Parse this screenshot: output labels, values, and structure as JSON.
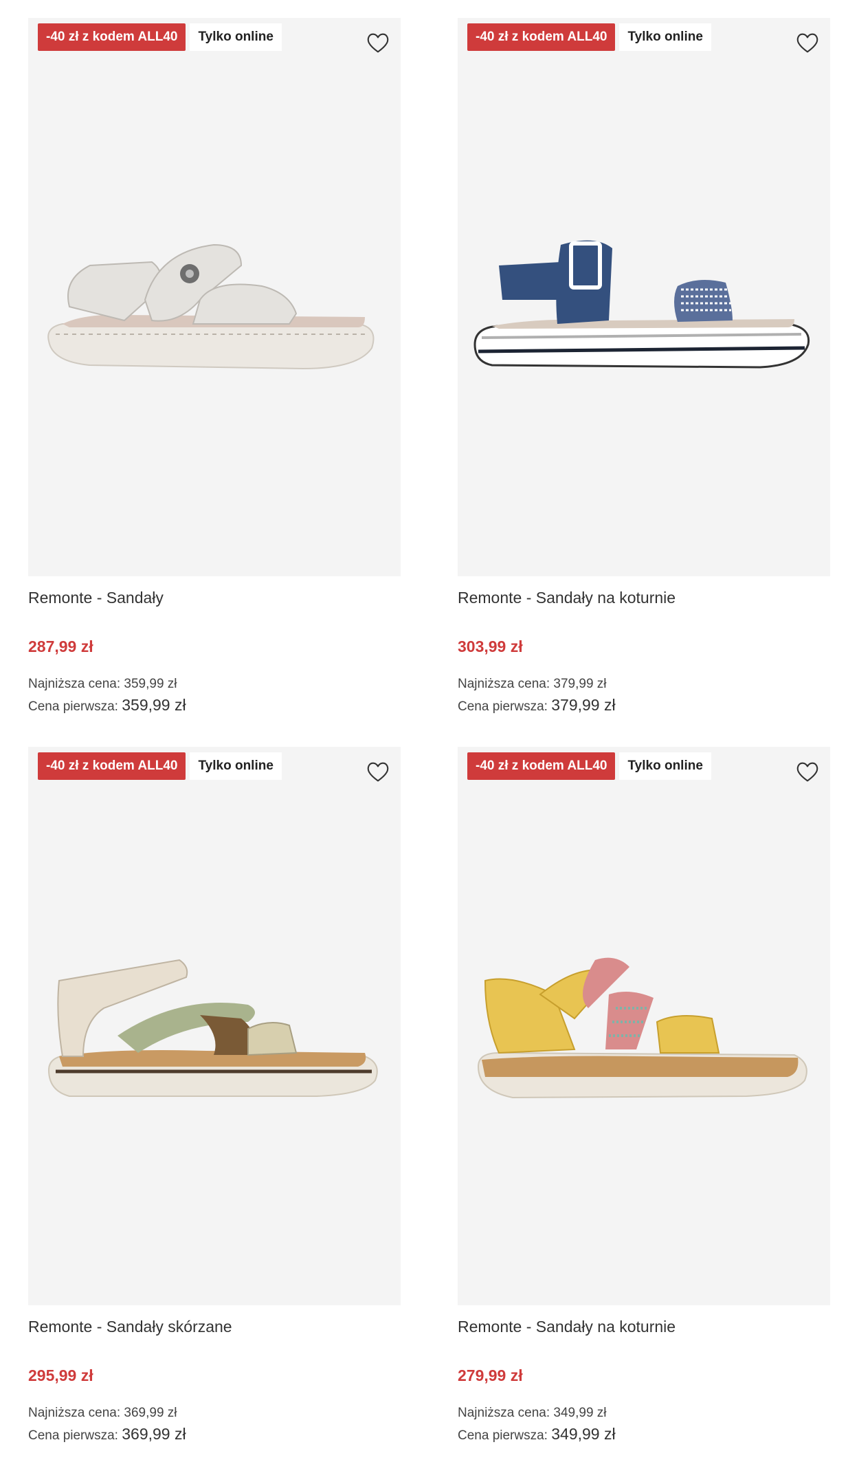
{
  "products": [
    {
      "promo_badge": "-40 zł z kodem ALL40",
      "online_badge": "Tylko online",
      "name": "Remonte - Sandały",
      "price": "287,99 zł",
      "lowest_price_label": "Najniższa cena:",
      "lowest_price": "359,99 zł",
      "first_price_label": "Cena pierwsza:",
      "first_price": "359,99 zł",
      "colors": {
        "strap": "#e4e2de",
        "sole": "#ece8e2",
        "footbed": "#d9c7bd",
        "accent": "#ffffff"
      }
    },
    {
      "promo_badge": "-40 zł z kodem ALL40",
      "online_badge": "Tylko online",
      "name": "Remonte - Sandały na koturnie",
      "price": "303,99 zł",
      "lowest_price_label": "Najniższa cena:",
      "lowest_price": "379,99 zł",
      "first_price_label": "Cena pierwsza:",
      "first_price": "379,99 zł",
      "colors": {
        "strap": "#34507e",
        "sole": "#ffffff",
        "footbed": "#d8cbbf",
        "accent": "#5a6f9b"
      }
    },
    {
      "promo_badge": "-40 zł z kodem ALL40",
      "online_badge": "Tylko online",
      "name": "Remonte - Sandały skórzane",
      "price": "295,99 zł",
      "lowest_price_label": "Najniższa cena:",
      "lowest_price": "369,99 zł",
      "first_price_label": "Cena pierwsza:",
      "first_price": "369,99 zł",
      "colors": {
        "strap": "#e8dfd0",
        "sole": "#ebe6dc",
        "footbed": "#c99a63",
        "accent": "#a9b38d"
      }
    },
    {
      "promo_badge": "-40 zł z kodem ALL40",
      "online_badge": "Tylko online",
      "name": "Remonte - Sandały na koturnie",
      "price": "279,99 zł",
      "lowest_price_label": "Najniższa cena:",
      "lowest_price": "349,99 zł",
      "first_price_label": "Cena pierwsza:",
      "first_price": "349,99 zł",
      "colors": {
        "strap": "#e8c452",
        "sole": "#ece6dc",
        "footbed": "#c6975e",
        "accent": "#d98c8c"
      }
    }
  ],
  "icons": {
    "favorite": "heart-outline-icon"
  },
  "theme": {
    "promo_red": "#cf3b3b",
    "image_bg": "#f4f4f4"
  }
}
